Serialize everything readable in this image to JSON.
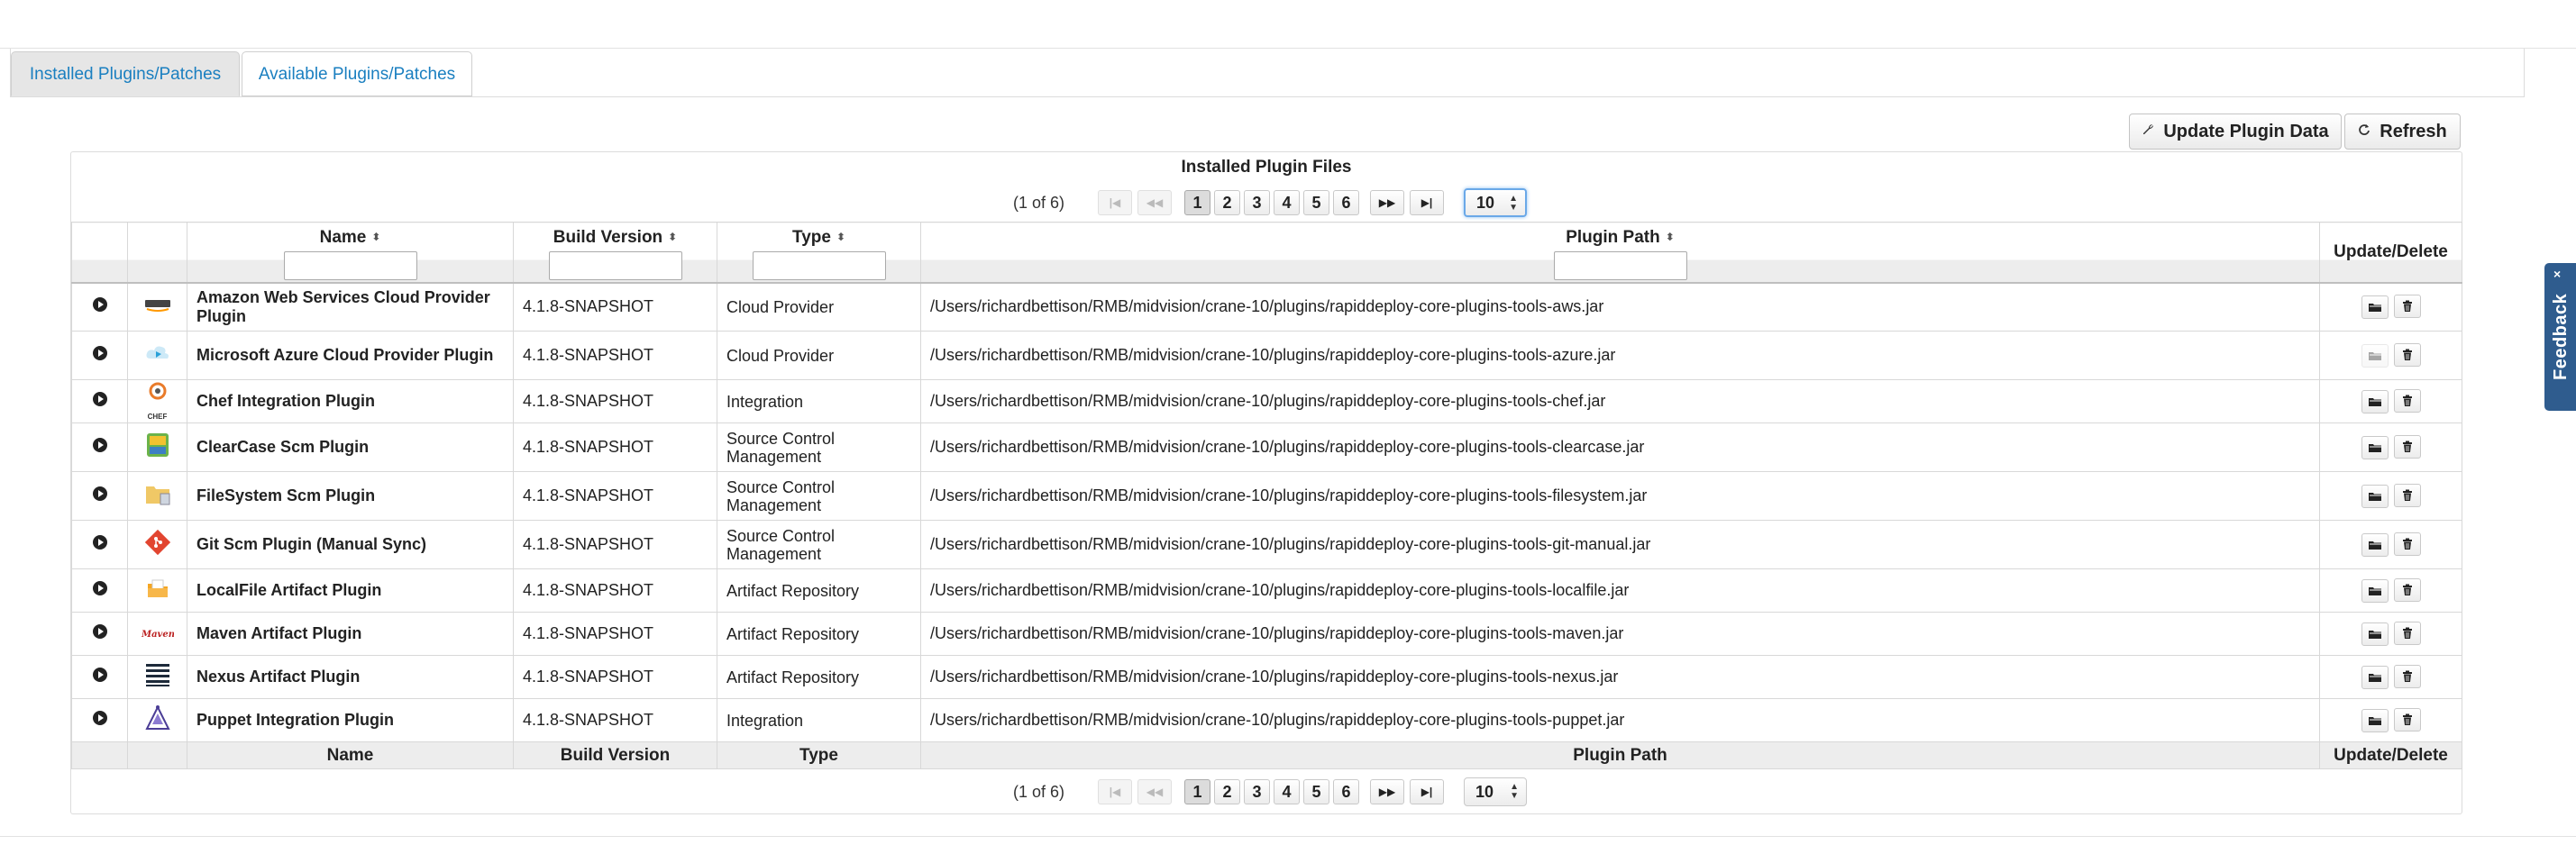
{
  "tabs": [
    {
      "label": "Installed Plugins/Patches",
      "active": true
    },
    {
      "label": "Available Plugins/Patches",
      "active": false
    }
  ],
  "toolbar": {
    "update_label": "Update Plugin Data",
    "refresh_label": "Refresh"
  },
  "table": {
    "caption": "Installed Plugin Files",
    "pager": {
      "count": "(1 of 6)",
      "pages": [
        "1",
        "2",
        "3",
        "4",
        "5",
        "6"
      ],
      "current_page": "1",
      "rows_per_page": "10",
      "first": "|◀",
      "prev": "◀◀",
      "next": "▶▶",
      "last": "▶|"
    },
    "columns": {
      "name": "Name",
      "build": "Build Version",
      "type": "Type",
      "path": "Plugin Path",
      "actions": "Update/Delete"
    },
    "rows": [
      {
        "name": "Amazon Web Services Cloud Provider Plugin",
        "build": "4.1.8-SNAPSHOT",
        "type": "Cloud Provider",
        "path": "/Users/richardbettison/RMB/midvision/crane-10/plugins/rapiddeploy-core-plugins-tools-aws.jar",
        "icon": "aws-icon",
        "update_enabled": true
      },
      {
        "name": "Microsoft Azure Cloud Provider Plugin",
        "build": "4.1.8-SNAPSHOT",
        "type": "Cloud Provider",
        "path": "/Users/richardbettison/RMB/midvision/crane-10/plugins/rapiddeploy-core-plugins-tools-azure.jar",
        "icon": "azure-icon",
        "update_enabled": false
      },
      {
        "name": "Chef Integration Plugin",
        "build": "4.1.8-SNAPSHOT",
        "type": "Integration",
        "path": "/Users/richardbettison/RMB/midvision/crane-10/plugins/rapiddeploy-core-plugins-tools-chef.jar",
        "icon": "chef-icon",
        "icon_text": "CHEF",
        "update_enabled": true
      },
      {
        "name": "ClearCase Scm Plugin",
        "build": "4.1.8-SNAPSHOT",
        "type": "Source Control Management",
        "path": "/Users/richardbettison/RMB/midvision/crane-10/plugins/rapiddeploy-core-plugins-tools-clearcase.jar",
        "icon": "clearcase-icon",
        "update_enabled": true
      },
      {
        "name": "FileSystem Scm Plugin",
        "build": "4.1.8-SNAPSHOT",
        "type": "Source Control Management",
        "path": "/Users/richardbettison/RMB/midvision/crane-10/plugins/rapiddeploy-core-plugins-tools-filesystem.jar",
        "icon": "filesystem-icon",
        "update_enabled": true
      },
      {
        "name": "Git Scm Plugin (Manual Sync)",
        "build": "4.1.8-SNAPSHOT",
        "type": "Source Control Management",
        "path": "/Users/richardbettison/RMB/midvision/crane-10/plugins/rapiddeploy-core-plugins-tools-git-manual.jar",
        "icon": "git-icon",
        "update_enabled": true
      },
      {
        "name": "LocalFile Artifact Plugin",
        "build": "4.1.8-SNAPSHOT",
        "type": "Artifact Repository",
        "path": "/Users/richardbettison/RMB/midvision/crane-10/plugins/rapiddeploy-core-plugins-tools-localfile.jar",
        "icon": "localfile-icon",
        "update_enabled": true
      },
      {
        "name": "Maven Artifact Plugin",
        "build": "4.1.8-SNAPSHOT",
        "type": "Artifact Repository",
        "path": "/Users/richardbettison/RMB/midvision/crane-10/plugins/rapiddeploy-core-plugins-tools-maven.jar",
        "icon": "maven-icon",
        "update_enabled": true
      },
      {
        "name": "Nexus Artifact Plugin",
        "build": "4.1.8-SNAPSHOT",
        "type": "Artifact Repository",
        "path": "/Users/richardbettison/RMB/midvision/crane-10/plugins/rapiddeploy-core-plugins-tools-nexus.jar",
        "icon": "nexus-icon",
        "update_enabled": true
      },
      {
        "name": "Puppet Integration Plugin",
        "build": "4.1.8-SNAPSHOT",
        "type": "Integration",
        "path": "/Users/richardbettison/RMB/midvision/crane-10/plugins/rapiddeploy-core-plugins-tools-puppet.jar",
        "icon": "puppet-icon",
        "update_enabled": true
      }
    ]
  },
  "feedback": {
    "label": "Feedback",
    "close": "×"
  },
  "colors": {
    "link": "#1a7fc0",
    "feedback_bg": "#2f5c8e",
    "header_band": "#ededed"
  }
}
